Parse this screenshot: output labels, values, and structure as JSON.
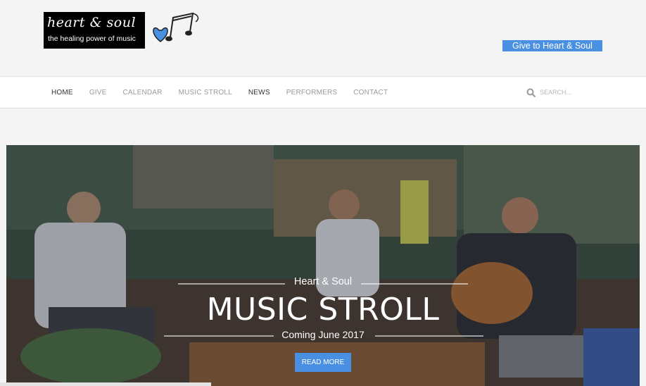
{
  "header": {
    "logo_title": "heart & soul",
    "logo_tagline": "the healing power of music",
    "give_label": "Give to Heart & Soul"
  },
  "nav": {
    "items": [
      {
        "label": "HOME"
      },
      {
        "label": "GIVE"
      },
      {
        "label": "CALENDAR"
      },
      {
        "label": "MUSIC STROLL"
      },
      {
        "label": "NEWS"
      },
      {
        "label": "PERFORMERS"
      },
      {
        "label": "CONTACT"
      }
    ],
    "active": "HOME",
    "search_placeholder": "SEARCH..."
  },
  "hero": {
    "kicker": "Heart & Soul",
    "title": "MUSIC STROLL",
    "subtitle": "Coming June 2017",
    "button_label": "READ MORE"
  },
  "colors": {
    "accent": "#4a90e2",
    "nav_active": "#333333",
    "nav_inactive": "#9a9a9a"
  }
}
